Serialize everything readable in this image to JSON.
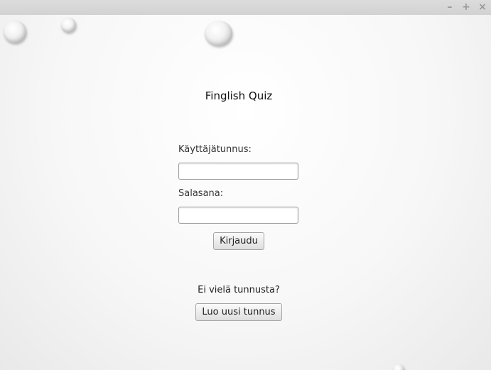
{
  "window": {
    "controls": {
      "minimize": "–",
      "maximize": "+",
      "close": "×"
    }
  },
  "login": {
    "title": "Finglish Quiz",
    "username_label": "Käyttäjätunnus:",
    "username_value": "",
    "password_label": "Salasana:",
    "password_value": "",
    "login_button": "Kirjaudu",
    "no_account_text": "Ei vielä tunnusta?",
    "create_account_button": "Luo uusi tunnus"
  }
}
